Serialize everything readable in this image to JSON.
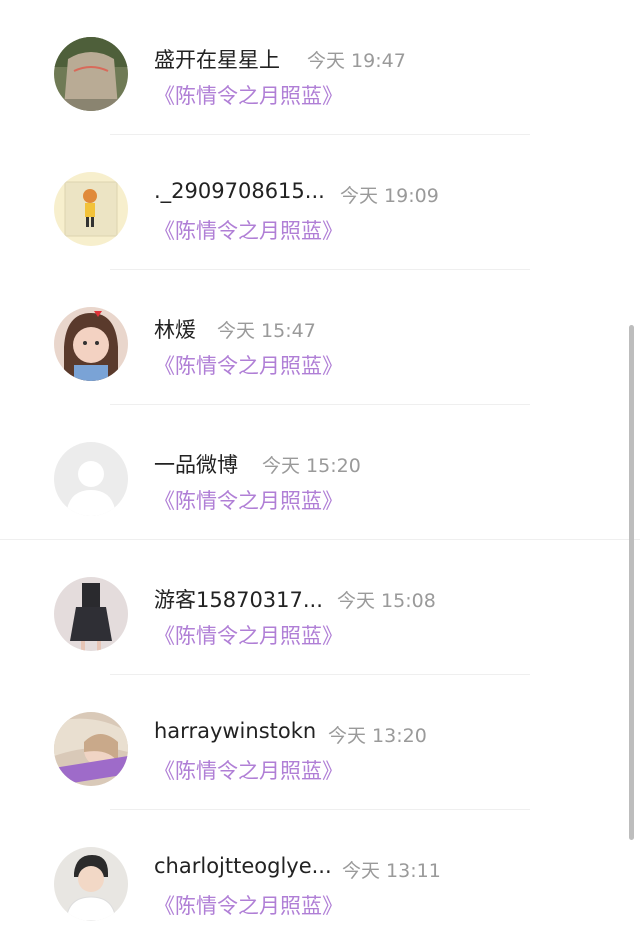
{
  "accent_color": "#b07fd6",
  "list": [
    {
      "name": "盛开在星星上",
      "time": "今天 19:47",
      "work": "《陈情令之月照蓝》",
      "avatar": "stone-avatar"
    },
    {
      "name": "._2909708615...",
      "time": "今天 19:09",
      "work": "《陈情令之月照蓝》",
      "avatar": "cartoon-avatar"
    },
    {
      "name": "林煖",
      "time": "今天 15:47",
      "work": "《陈情令之月照蓝》",
      "avatar": "child-avatar"
    },
    {
      "name": "一品微博",
      "time": "今天 15:20",
      "work": "《陈情令之月照蓝》",
      "avatar": "default-avatar"
    },
    {
      "name": "游客15870317...",
      "time": "今天 15:08",
      "work": "《陈情令之月照蓝》",
      "avatar": "dress-avatar"
    },
    {
      "name": "harraywinstokn",
      "time": "今天 13:20",
      "work": "《陈情令之月照蓝》",
      "avatar": "girl-avatar"
    },
    {
      "name": "charlojtteoglye...",
      "time": "今天 13:11",
      "work": "《陈情令之月照蓝》",
      "avatar": "boy-avatar"
    }
  ]
}
